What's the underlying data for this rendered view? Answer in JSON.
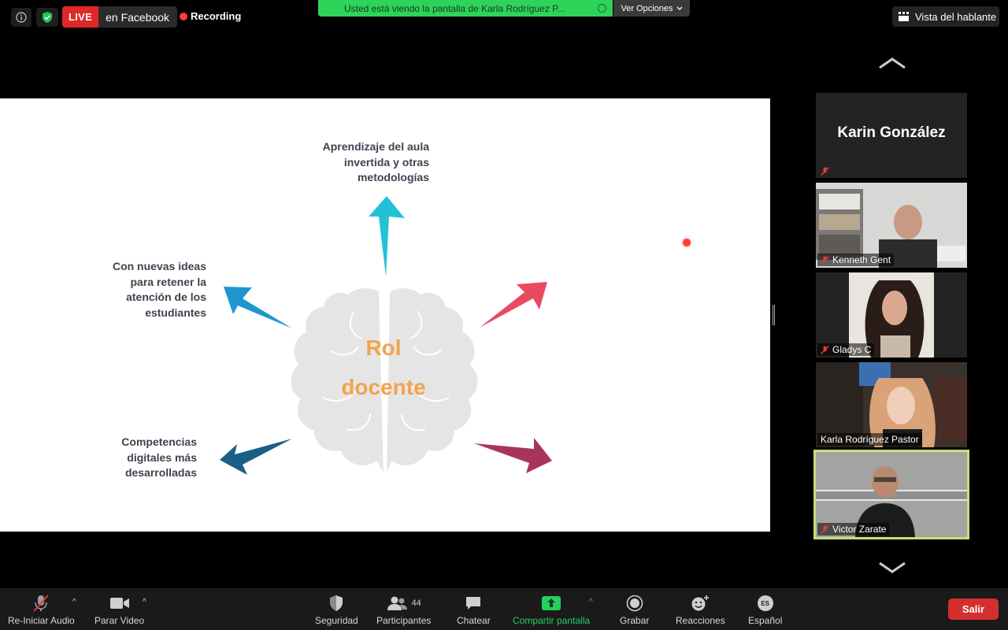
{
  "top_bar": {
    "live_label": "LIVE",
    "live_destination": "en Facebook",
    "recording_label": "Recording",
    "share_banner": "Usted está viendo la pantalla de Karla Rodríguez P...",
    "view_options": "Ver Opciones",
    "speaker_view": "Vista del hablante"
  },
  "slide": {
    "title_line1": "Rol",
    "title_line2": "docente",
    "text_top": "Aprendizaje del aula invertida y otras metodologías",
    "text_left": "Con nuevas ideas para retener la atención de los estudiantes",
    "text_bottom": "Competencias digitales más desarrolladas",
    "colors": {
      "title": "#f2a34c",
      "arrow_top": "#23c1d6",
      "arrow_left": "#1e97d1",
      "arrow_bottom_left": "#1b5f86",
      "arrow_right": "#e84a5f",
      "arrow_bottom_right": "#a8345c",
      "brain": "#e5e5e5"
    }
  },
  "participants": [
    {
      "name": "Karin González",
      "video": false
    },
    {
      "name": "Kenneth Gent",
      "video": true
    },
    {
      "name": "Gladys C",
      "video": true
    },
    {
      "name": "Karla Rodríguez Pastor",
      "video": true
    },
    {
      "name": "Victor Zarate",
      "video": true,
      "active_speaker": true
    }
  ],
  "toolbar": {
    "audio": "Re-Iniciar Audio",
    "video": "Parar Video",
    "security": "Seguridad",
    "participants": "Participantes",
    "participants_count": "44",
    "chat": "Chatear",
    "share": "Compartir pantalla",
    "record": "Grabar",
    "reactions": "Reacciones",
    "language": "Español",
    "language_code": "ES",
    "leave": "Salir"
  }
}
